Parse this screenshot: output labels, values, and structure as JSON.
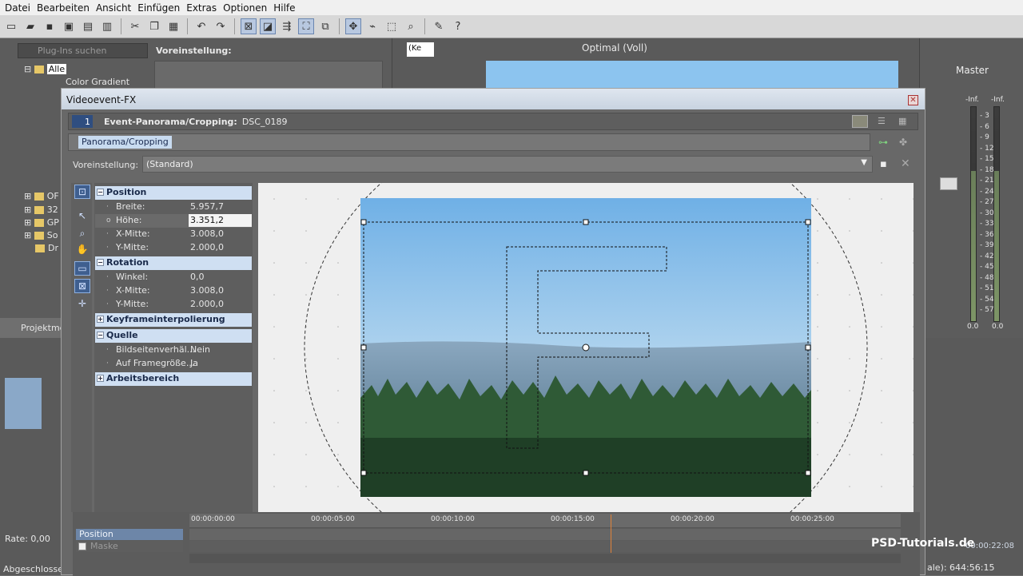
{
  "menu": [
    "Datei",
    "Bearbeiten",
    "Ansicht",
    "Einfügen",
    "Extras",
    "Optionen",
    "Hilfe"
  ],
  "plugin_search": {
    "placeholder": "Plug-Ins suchen"
  },
  "tree": {
    "all": "Alle",
    "first": "Color Gradient",
    "folders": [
      "OF",
      "32",
      "GP",
      "So",
      "Dr"
    ]
  },
  "project_tab": "Projektme",
  "preset_heading": "Voreinstellung:",
  "preview": {
    "quality": "Optimal (Voll)",
    "dropdown": "(Ke"
  },
  "mixer": {
    "master": "Master",
    "inf_left": "-Inf.",
    "inf_right": "-Inf.",
    "zero_left": "0.0",
    "zero_right": "0.0",
    "scale": [
      "3",
      "6",
      "9",
      "12",
      "15",
      "18",
      "21",
      "24",
      "27",
      "30",
      "33",
      "36",
      "39",
      "42",
      "45",
      "48",
      "51",
      "54",
      "57"
    ]
  },
  "dialog": {
    "title": "Videoevent-FX",
    "event_num": "1",
    "event_label": "Event-Panorama/Cropping:",
    "event_name": "DSC_0189",
    "chain_tag": "Panorama/Cropping",
    "preset_label": "Voreinstellung:",
    "preset_value": "(Standard)"
  },
  "props": {
    "position": {
      "title": "Position",
      "breite_k": "Breite:",
      "breite_v": "5.957,7",
      "hoehe_k": "Höhe:",
      "hoehe_v": "3.351,2",
      "xm_k": "X-Mitte:",
      "xm_v": "3.008,0",
      "ym_k": "Y-Mitte:",
      "ym_v": "2.000,0"
    },
    "rotation": {
      "title": "Rotation",
      "winkel_k": "Winkel:",
      "winkel_v": "0,0",
      "xm_k": "X-Mitte:",
      "xm_v": "3.008,0",
      "ym_k": "Y-Mitte:",
      "ym_v": "2.000,0"
    },
    "keyframe": {
      "title": "Keyframeinterpolierung"
    },
    "quelle": {
      "title": "Quelle",
      "bsv_k": "Bildseitenverhäl...",
      "bsv_v": "Nein",
      "afg_k": "Auf Framegröße...",
      "afg_v": "Ja"
    },
    "arbeitsbereich": {
      "title": "Arbeitsbereich"
    }
  },
  "keyframes": {
    "pos_label": "Position",
    "mask_label": "Maske",
    "ticks": [
      "00:00:00:00",
      "00:00:05:00",
      "00:00:10:00",
      "00:00:15:00",
      "00:00:20:00",
      "00:00:25:00"
    ]
  },
  "status": {
    "rate": "Rate: 0,00",
    "abgeschlossen": "Abgeschlossen",
    "tc_right": "ale): 644:56:15",
    "tc_right2": "00:00:22:08"
  },
  "watermark": "PSD-Tutorials.de"
}
